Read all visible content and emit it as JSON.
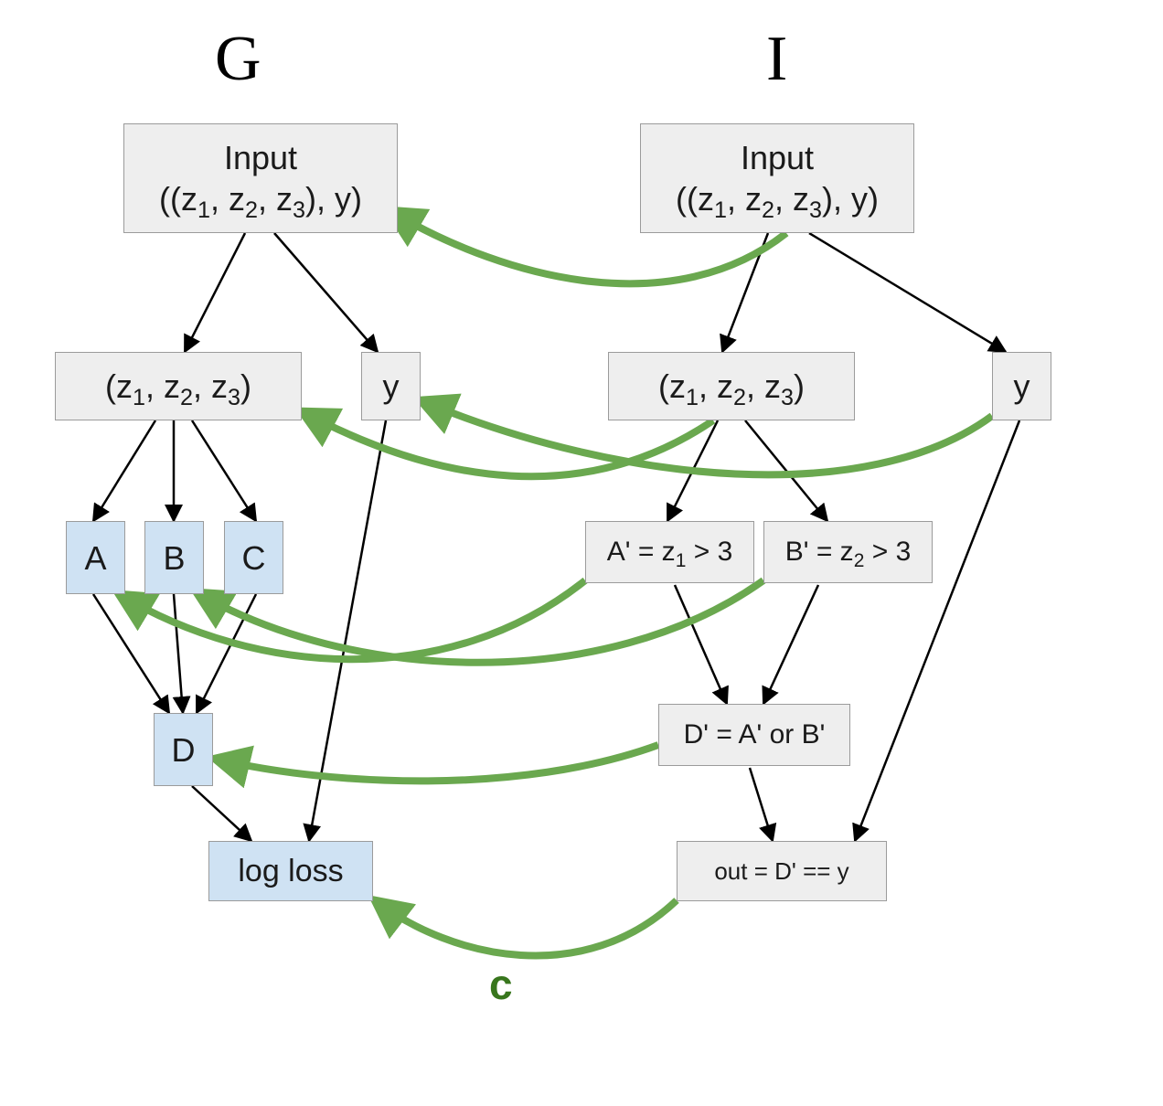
{
  "titles": {
    "G": "G",
    "I": "I"
  },
  "correspondence_label": "c",
  "G": {
    "input_line1": "Input",
    "input_line2": "((z1, z2, z3), y)",
    "ztuple": "(z1, z2, z3)",
    "y": "y",
    "A": "A",
    "B": "B",
    "C": "C",
    "D": "D",
    "logloss": "log loss"
  },
  "I": {
    "input_line1": "Input",
    "input_line2": "((z1, z2, z3), y)",
    "ztuple": "(z1, z2, z3)",
    "y": "y",
    "Aprime": "A' = z1 > 3",
    "Bprime": "B' = z2 > 3",
    "Dprime": "D' = A' or B'",
    "out": "out = D' == y"
  },
  "edges_black": [
    [
      "G.input",
      "G.ztuple"
    ],
    [
      "G.input",
      "G.y"
    ],
    [
      "G.ztuple",
      "G.A"
    ],
    [
      "G.ztuple",
      "G.B"
    ],
    [
      "G.ztuple",
      "G.C"
    ],
    [
      "G.A",
      "G.D"
    ],
    [
      "G.B",
      "G.D"
    ],
    [
      "G.C",
      "G.D"
    ],
    [
      "G.D",
      "G.logloss"
    ],
    [
      "G.y",
      "G.logloss"
    ],
    [
      "I.input",
      "I.ztuple"
    ],
    [
      "I.input",
      "I.y"
    ],
    [
      "I.ztuple",
      "I.Aprime"
    ],
    [
      "I.ztuple",
      "I.Bprime"
    ],
    [
      "I.Aprime",
      "I.Dprime"
    ],
    [
      "I.Bprime",
      "I.Dprime"
    ],
    [
      "I.Dprime",
      "I.out"
    ],
    [
      "I.y",
      "I.out"
    ]
  ],
  "edges_green_correspondence": [
    [
      "I.input",
      "G.input"
    ],
    [
      "I.ztuple",
      "G.ztuple"
    ],
    [
      "I.y",
      "G.y"
    ],
    [
      "I.Aprime",
      "G.A"
    ],
    [
      "I.Bprime",
      "G.B"
    ],
    [
      "I.Dprime",
      "G.D"
    ],
    [
      "I.out",
      "G.logloss"
    ]
  ],
  "colors": {
    "grey_fill": "#eeeeee",
    "blue_fill": "#cfe2f3",
    "edge_black": "#000000",
    "edge_green": "#6aa84f",
    "label_green": "#38761d"
  }
}
